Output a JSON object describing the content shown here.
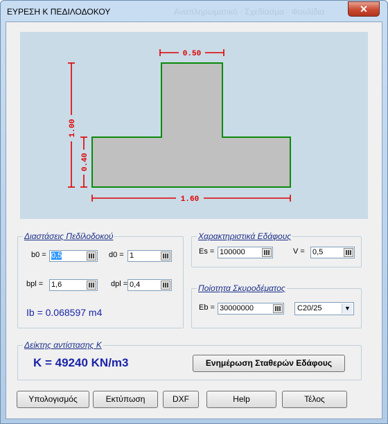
{
  "window": {
    "title": "ΕΥΡΕΣΗ Κ ΠΕΔΙΛΟΔΟΚΟΥ",
    "ghost_title": "Αναπληρωματικό · Σχεδίασμα · Φουλίδια",
    "close_glyph": "✕"
  },
  "drawing": {
    "dim_top": "0.50",
    "dim_left_total": "1.00",
    "dim_left_flange": "0.40",
    "dim_bottom": "1.60",
    "colors": {
      "background": "#c9dbe6",
      "section_fill": "#c0c0c0",
      "outline": "#0a8a0a",
      "dimension": "#dd0000"
    }
  },
  "geometry_group": {
    "legend": "Διαστάσεις Πεδίλοδοκού",
    "b0": {
      "label": "b0 =",
      "value": "0,5"
    },
    "d0": {
      "label": "d0 =",
      "value": "1"
    },
    "bpl": {
      "label": "bpl =",
      "value": "1,6"
    },
    "dpl": {
      "label": "dpl =",
      "value": "0,4"
    },
    "ib": "Ib = 0.068597 m4"
  },
  "soil_group": {
    "legend": "Χαρακτηριστικά Εδάφους",
    "es": {
      "label": "Es =",
      "value": "100000"
    },
    "v": {
      "label": "V =",
      "value": "0,5"
    }
  },
  "concrete_group": {
    "legend": "Ποίοτητα Σκυροδέματος",
    "eb": {
      "label": "Eb =",
      "value": "30000000"
    },
    "grade": "C20/25"
  },
  "k_group": {
    "legend": "Δείκτης αντίστασης Κ",
    "k_value": "K = 49240 KN/m3",
    "update_button": "Ενημέρωση Σταθερών Εδάφους"
  },
  "buttons": {
    "calculate": "Υπολογισμός",
    "print": "Εκτύπωση",
    "dxf": "DXF",
    "help": "Help",
    "end": "Τέλος"
  },
  "colors": {
    "group_title": "#1a2e8a",
    "result_text": "#1a24a8"
  }
}
